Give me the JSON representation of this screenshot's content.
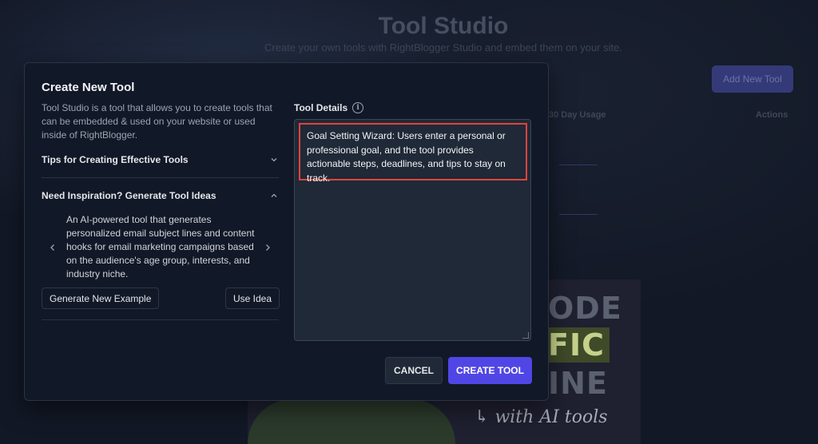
{
  "background": {
    "title": "Tool Studio",
    "subtitle": "Create your own tools with RightBlogger Studio and embed them on your site.",
    "add_button": "Add New Tool",
    "columns": {
      "usage": "30 Day Usage",
      "actions": "Actions"
    },
    "video": {
      "line1": "ODE",
      "line2": "FIC",
      "line3": "INE",
      "tagline": "with AI tools"
    }
  },
  "modal": {
    "title": "Create New Tool",
    "description": "Tool Studio is a tool that allows you to create tools that can be embedded & used on your website or used inside of RightBlogger.",
    "accordions": [
      {
        "label": "Tips for Creating Effective Tools",
        "icon": "chevron-down-icon"
      },
      {
        "label": "Need Inspiration? Generate Tool Ideas",
        "icon": "chevron-up-icon"
      }
    ],
    "idea": {
      "text": "An AI-powered tool that generates personalized email subject lines and content hooks for email marketing campaigns based on the audience's age group, interests, and industry niche.",
      "generate_button": "Generate New Example",
      "use_button": "Use Idea"
    },
    "details": {
      "label": "Tool Details",
      "info_icon": "info-icon",
      "value": "Goal Setting Wizard: Users enter a personal or professional goal, and the tool provides actionable steps, deadlines, and tips to stay on track.",
      "highlight_color": "#e0443a"
    },
    "actions": {
      "cancel": "CANCEL",
      "create": "CREATE TOOL"
    },
    "colors": {
      "accent": "#5046e5",
      "surface": "#111827"
    }
  }
}
